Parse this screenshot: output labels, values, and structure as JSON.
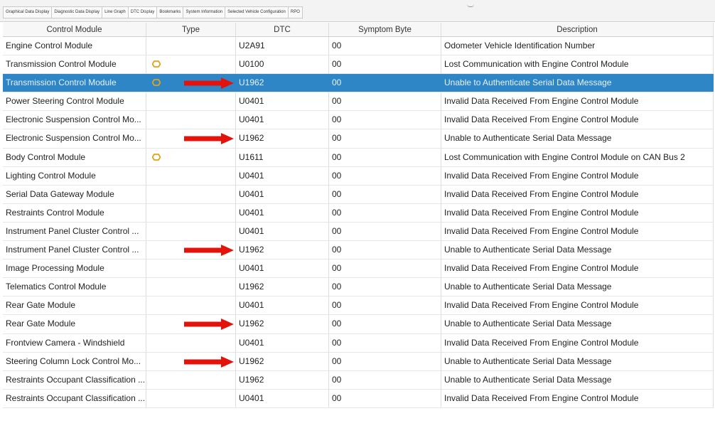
{
  "tabs": [
    {
      "label": "Graphical Data Display",
      "active": false
    },
    {
      "label": "Diagnostic Data Display",
      "active": false
    },
    {
      "label": "Line Graph",
      "active": false
    },
    {
      "label": "DTC Display",
      "active": true
    },
    {
      "label": "Bookmarks",
      "active": false
    },
    {
      "label": "System Information",
      "active": false
    },
    {
      "label": "Selected Vehicle Configuration",
      "active": false
    },
    {
      "label": "RPO",
      "active": false
    }
  ],
  "table": {
    "columns": [
      "Control Module",
      "Type",
      "DTC",
      "Symptom Byte",
      "Description"
    ],
    "rows": [
      {
        "module": "Engine Control Module",
        "type_icon": "",
        "dtc": "U2A91",
        "symptom": "00",
        "description": "Odometer Vehicle Identification Number",
        "arrow": false,
        "selected": false
      },
      {
        "module": "Transmission Control Module",
        "type_icon": "warning-icon",
        "dtc": "U0100",
        "symptom": "00",
        "description": "Lost Communication with Engine Control Module",
        "arrow": false,
        "selected": false
      },
      {
        "module": "Transmission Control Module",
        "type_icon": "warning-icon",
        "dtc": "U1962",
        "symptom": "00",
        "description": "Unable to Authenticate Serial Data Message",
        "arrow": true,
        "selected": true
      },
      {
        "module": "Power Steering Control Module",
        "type_icon": "",
        "dtc": "U0401",
        "symptom": "00",
        "description": "Invalid Data Received From Engine Control Module",
        "arrow": false,
        "selected": false
      },
      {
        "module": "Electronic Suspension Control Mo...",
        "type_icon": "",
        "dtc": "U0401",
        "symptom": "00",
        "description": "Invalid Data Received From Engine Control Module",
        "arrow": false,
        "selected": false
      },
      {
        "module": "Electronic Suspension Control Mo...",
        "type_icon": "",
        "dtc": "U1962",
        "symptom": "00",
        "description": "Unable to Authenticate Serial Data Message",
        "arrow": true,
        "selected": false
      },
      {
        "module": "Body Control Module",
        "type_icon": "warning-icon",
        "dtc": "U1611",
        "symptom": "00",
        "description": "Lost Communication with Engine Control Module on CAN Bus 2",
        "arrow": false,
        "selected": false
      },
      {
        "module": "Lighting Control Module",
        "type_icon": "",
        "dtc": "U0401",
        "symptom": "00",
        "description": "Invalid Data Received From Engine Control Module",
        "arrow": false,
        "selected": false
      },
      {
        "module": "Serial Data Gateway Module",
        "type_icon": "",
        "dtc": "U0401",
        "symptom": "00",
        "description": "Invalid Data Received From Engine Control Module",
        "arrow": false,
        "selected": false
      },
      {
        "module": "Restraints Control Module",
        "type_icon": "",
        "dtc": "U0401",
        "symptom": "00",
        "description": "Invalid Data Received From Engine Control Module",
        "arrow": false,
        "selected": false
      },
      {
        "module": "Instrument Panel Cluster Control ...",
        "type_icon": "",
        "dtc": "U0401",
        "symptom": "00",
        "description": "Invalid Data Received From Engine Control Module",
        "arrow": false,
        "selected": false
      },
      {
        "module": "Instrument Panel Cluster Control ...",
        "type_icon": "",
        "dtc": "U1962",
        "symptom": "00",
        "description": "Unable to Authenticate Serial Data Message",
        "arrow": true,
        "selected": false
      },
      {
        "module": "Image Processing Module",
        "type_icon": "",
        "dtc": "U0401",
        "symptom": "00",
        "description": "Invalid Data Received From Engine Control Module",
        "arrow": false,
        "selected": false
      },
      {
        "module": "Telematics Control Module",
        "type_icon": "",
        "dtc": "U1962",
        "symptom": "00",
        "description": "Unable to Authenticate Serial Data Message",
        "arrow": false,
        "selected": false
      },
      {
        "module": "Rear Gate Module",
        "type_icon": "",
        "dtc": "U0401",
        "symptom": "00",
        "description": "Invalid Data Received From Engine Control Module",
        "arrow": false,
        "selected": false
      },
      {
        "module": "Rear Gate Module",
        "type_icon": "",
        "dtc": "U1962",
        "symptom": "00",
        "description": "Unable to Authenticate Serial Data Message",
        "arrow": true,
        "selected": false
      },
      {
        "module": "Frontview Camera - Windshield",
        "type_icon": "",
        "dtc": "U0401",
        "symptom": "00",
        "description": "Invalid Data Received From Engine Control Module",
        "arrow": false,
        "selected": false
      },
      {
        "module": "Steering Column Lock Control Mo...",
        "type_icon": "",
        "dtc": "U1962",
        "symptom": "00",
        "description": "Unable to Authenticate Serial Data Message",
        "arrow": true,
        "selected": false
      },
      {
        "module": "Restraints Occupant Classification ...",
        "type_icon": "",
        "dtc": "U1962",
        "symptom": "00",
        "description": "Unable to Authenticate Serial Data Message",
        "arrow": false,
        "selected": false
      },
      {
        "module": "Restraints Occupant Classification ...",
        "type_icon": "",
        "dtc": "U0401",
        "symptom": "00",
        "description": "Invalid Data Received From Engine Control Module",
        "arrow": false,
        "selected": false
      }
    ]
  },
  "colors": {
    "selection": "#2f86c7",
    "warning_icon": "#e0a31a",
    "arrow": "#e3120b"
  }
}
